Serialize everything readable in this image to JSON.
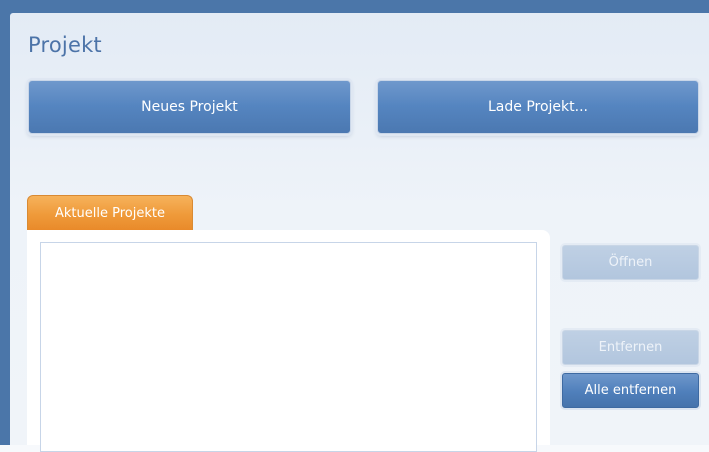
{
  "window": {
    "title": "Projekt"
  },
  "toolbar": {
    "new_project_label": "Neues Projekt",
    "load_project_label": "Lade Projekt..."
  },
  "tabs": [
    {
      "label": "Aktuelle Projekte",
      "active": true
    }
  ],
  "recent_projects": {
    "items": []
  },
  "side_buttons": {
    "open_label": "Öffnen",
    "open_enabled": false,
    "remove_label": "Entfernen",
    "remove_enabled": false,
    "remove_all_label": "Alle entfernen",
    "remove_all_enabled": true
  },
  "colors": {
    "accent_blue": "#4f7fbb",
    "tab_orange": "#ef9a3a",
    "title_blue": "#4c73a8",
    "frame_blue": "#4b76a9"
  }
}
